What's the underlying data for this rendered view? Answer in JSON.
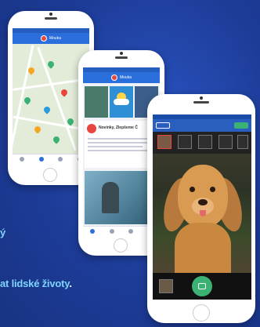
{
  "headline": {
    "line1": "ý",
    "line2_text": "at lidské životy",
    "line2_dot": "."
  },
  "app": {
    "name": "Mouka",
    "news_title": "Novinky, Zlepšeme Č",
    "camera_record_label": "REC"
  },
  "colors": {
    "background": "#1f3f9a",
    "headline": "#7fd3ff",
    "appbar": "#2a6fdb",
    "brand": "#e8463c",
    "record": "#3bb273"
  }
}
